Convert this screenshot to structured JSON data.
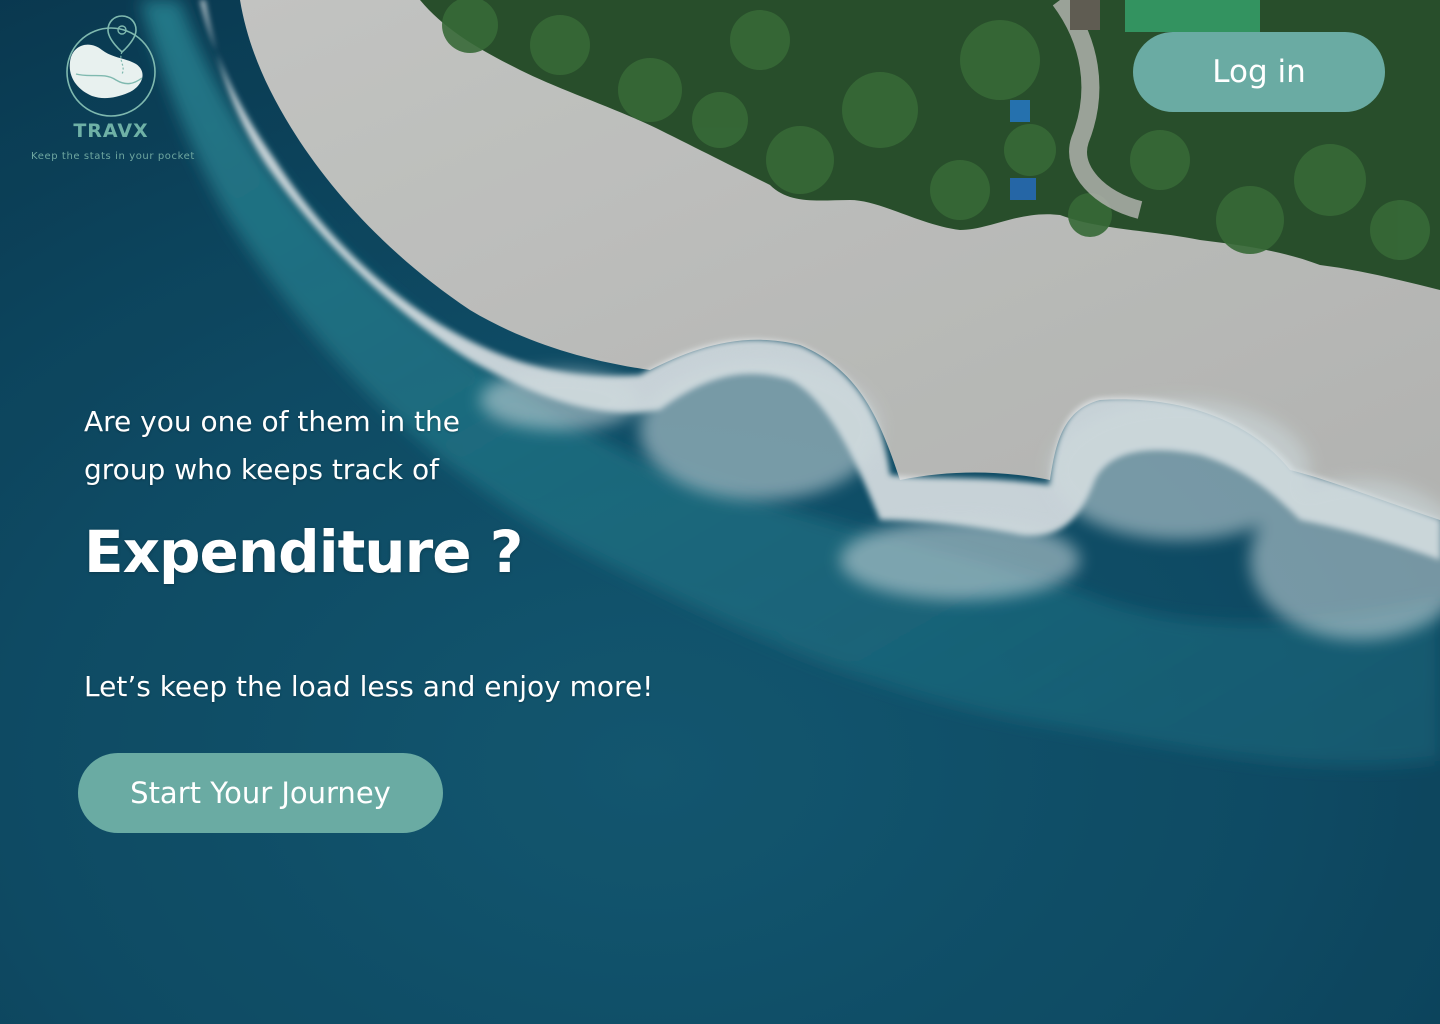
{
  "brand": {
    "name": "TRAVX",
    "tagline": "Keep the stats in your pocket",
    "logo_icon": "map-pin-globe-icon",
    "accent_color": "#6aaba3"
  },
  "header": {
    "login_label": "Log in"
  },
  "hero": {
    "question_line1": "Are you one of them in the",
    "question_line2": "group who keeps track of",
    "title": "Expenditure ?",
    "subtitle": "Let’s keep the load less and enjoy more!",
    "cta_label": "Start Your Journey"
  },
  "background": {
    "image_icon": "aerial-beach-photo",
    "ocean_color": "#0f5672",
    "sand_color": "#d6d3ce",
    "foliage_color": "#2f5a2c"
  }
}
